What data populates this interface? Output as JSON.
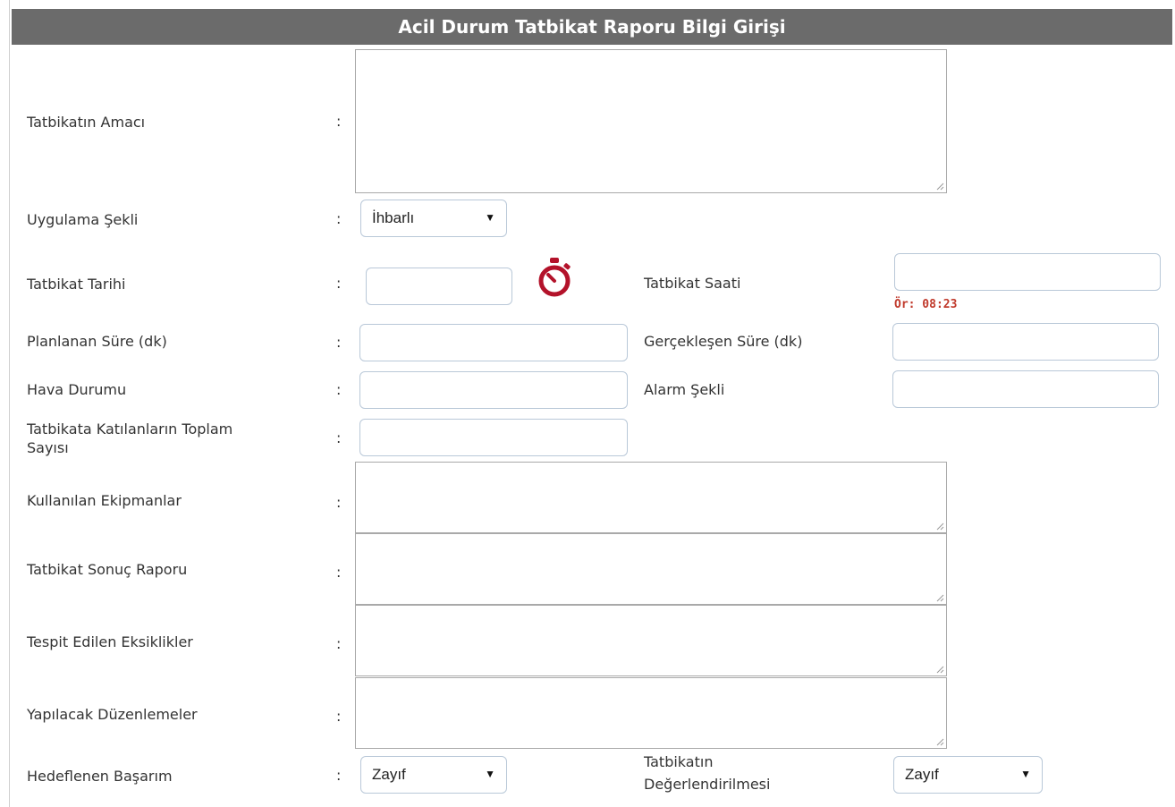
{
  "header": {
    "title": "Acil Durum Tatbikat Raporu Bilgi Girişi"
  },
  "colon": ":",
  "fields": {
    "amac": {
      "label": "Tatbikatın Amacı",
      "value": ""
    },
    "uygulama": {
      "label": "Uygulama Şekli",
      "selected": "İhbarlı"
    },
    "tarih": {
      "label": "Tatbikat Tarihi",
      "value": ""
    },
    "saat": {
      "label": "Tatbikat Saati",
      "value": "",
      "hint": "Ör: 08:23"
    },
    "planlanan": {
      "label": "Planlanan Süre (dk)",
      "value": ""
    },
    "gerceklesen": {
      "label": "Gerçekleşen Süre (dk)",
      "value": ""
    },
    "hava": {
      "label": "Hava Durumu",
      "value": ""
    },
    "alarm": {
      "label": "Alarm Şekli",
      "value": ""
    },
    "katilan": {
      "label_line1": "Tatbikata Katılanların Toplam",
      "label_line2": "Sayısı",
      "value": ""
    },
    "ekipman": {
      "label": "Kullanılan Ekipmanlar",
      "value": ""
    },
    "sonuc": {
      "label": "Tatbikat Sonuç Raporu",
      "value": ""
    },
    "eksik": {
      "label": "Tespit Edilen Eksiklikler",
      "value": ""
    },
    "duzenleme": {
      "label": "Yapılacak Düzenlemeler",
      "value": ""
    },
    "basarim": {
      "label": "Hedeflenen Başarım",
      "selected": "Zayıf"
    },
    "degerlendirme": {
      "label_line1": "Tatbikatın",
      "label_line2": "Değerlendirilmesi",
      "selected": "Zayıf"
    }
  },
  "icons": {
    "timer": "stopwatch-icon",
    "dropdown": "caret-down-icon",
    "resize": "resize-grip-icon"
  },
  "colors": {
    "header_bg": "#6b6b6b",
    "timer": "#b3122a",
    "hint": "#c0392b"
  }
}
